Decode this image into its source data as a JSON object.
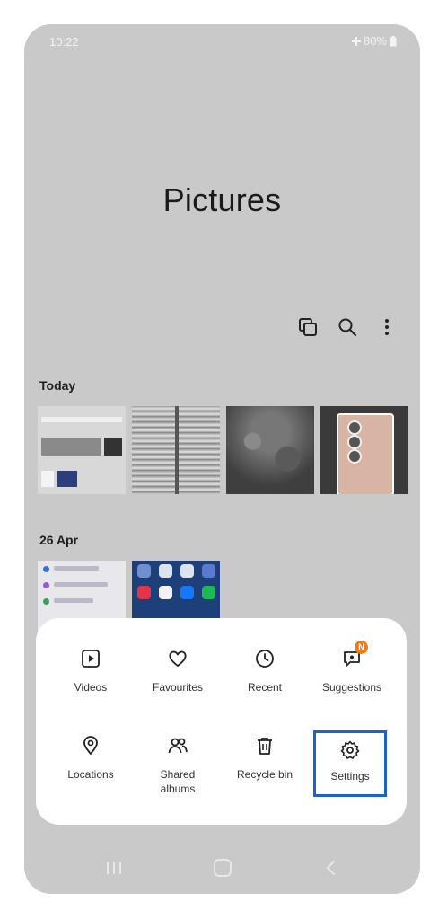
{
  "status_bar": {
    "time": "10:22",
    "battery": "80%"
  },
  "header": {
    "title": "Pictures"
  },
  "toolbar": {
    "icons": [
      "select-multiple-icon",
      "search-icon",
      "more-options-icon"
    ]
  },
  "sections": [
    {
      "label": "Today"
    },
    {
      "label": "26 Apr"
    }
  ],
  "menu": {
    "items": [
      {
        "label": "Videos",
        "icon": "play-video-icon"
      },
      {
        "label": "Favourites",
        "icon": "heart-icon"
      },
      {
        "label": "Recent",
        "icon": "clock-icon"
      },
      {
        "label": "Suggestions",
        "icon": "suggestions-icon",
        "badge": "N"
      },
      {
        "label": "Locations",
        "icon": "location-pin-icon"
      },
      {
        "label": "Shared albums",
        "icon": "people-icon"
      },
      {
        "label": "Recycle bin",
        "icon": "trash-icon"
      },
      {
        "label": "Settings",
        "icon": "gear-icon"
      }
    ]
  },
  "colors": {
    "highlight": "#1f63c9",
    "badge": "#f07a1a",
    "background": "#c9c9c9"
  }
}
